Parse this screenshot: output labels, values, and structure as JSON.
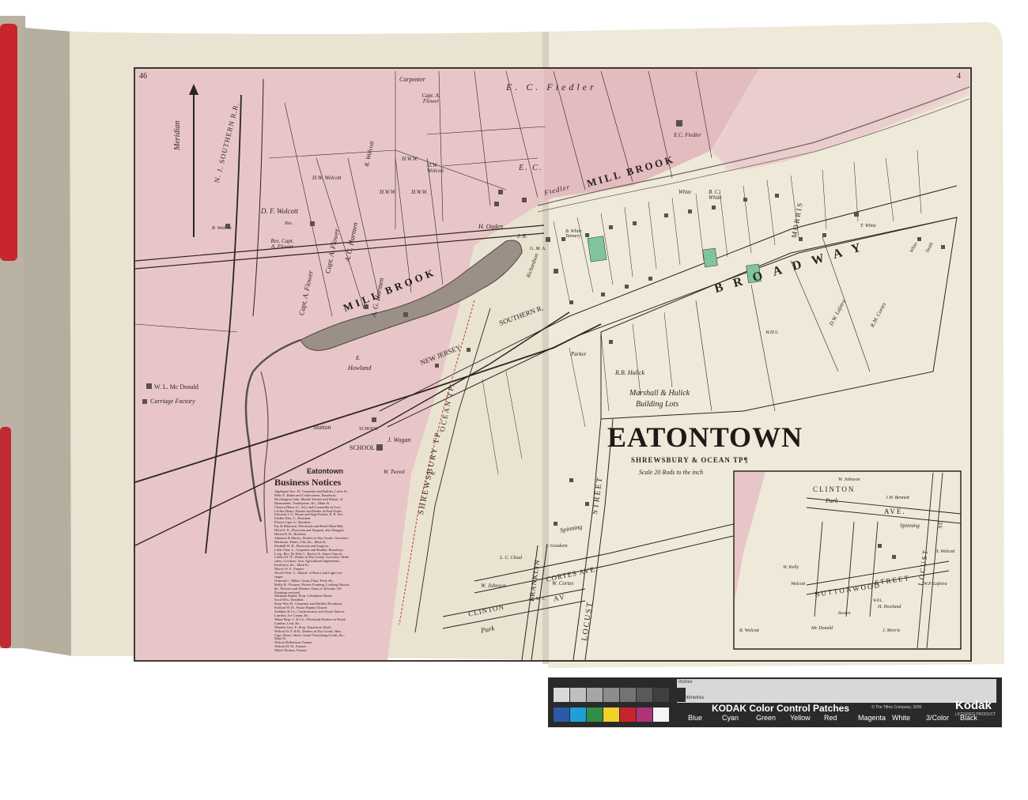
{
  "page": {
    "left_number": "46",
    "right_number": "4",
    "town_title": "EATONTOWN",
    "township": "SHREWSBURY & OCEAN TP¶",
    "scale_note": "Scale 20 Rods to the inch"
  },
  "compass": {
    "label": "Meridian"
  },
  "railroads": {
    "nj_southern": "N. J. SOUTHERN R.R.",
    "southern_r": "SOUTHERN R.",
    "new_jersey": "NEW JERSEY"
  },
  "waterways": {
    "mill_brook_upper": "MILL BROOK",
    "mill_brook_pond": "MILL BROOK"
  },
  "streets": {
    "broadway": "BROADWAY",
    "morris": "MORRIS",
    "shrewsbury_tp": "SHREWSBURY TP.",
    "ocean_tp": "OCEAN TP.",
    "locust": "LOCUST",
    "street": "STREET",
    "franklin": "FRANKLIN",
    "cortes_ave": "CORTES AVE.",
    "clinton": "CLINTON",
    "park": "Park",
    "av": "AV"
  },
  "owners": {
    "carpenter": "Carpenter",
    "ec_fiedler_top": "E. C. Fiedler",
    "ec_fiedler_house": "E.C. Fiedler",
    "ec": "E. C.",
    "fiedler": "Fiedler",
    "capt_a_flower_top": "Capt. A. Flower",
    "r_wolcott": "R. Wolcott",
    "hww_1": "H.W.W.",
    "hww_2": "H.W.W.",
    "hw_wolcott_1": "H.W. Wolcott",
    "hw_wolcott_2": "H.W. Wolcott",
    "hww_3": "H.W.W.",
    "df_wolcott": "D. F. Wolcott",
    "res_1": "Res.",
    "r_wolcott_res": "R. Wolcott",
    "res_capt": "Res. Capt. A. Flower",
    "capt_a_flower_mid": "Capt. A. Flower",
    "ag_harmen_1": "A. G. Harmen",
    "ag_harmen_2": "A. G. Harmen",
    "capt_a_flower_low": "Capt. A. Flower",
    "capt_flower_right": "Capt. A. Flower",
    "ogden": "H. Ogden",
    "jr": "J. R.",
    "gma": "G. M. A.",
    "richardson": "Richardson",
    "b_white_tannery": "B. White Tannery",
    "bc_white": "B. C. White",
    "white": "White",
    "howland": "Howland",
    "e": "E.",
    "station": "Station",
    "school_small": "SCHOOL",
    "school": "SCHOOL",
    "j_wogan": "J. Wogan",
    "w_tweed": "W. Tweed",
    "wl_mcdonald": "W. L. Mc Donald",
    "carriage_factory": "Carriage Factory",
    "marshall_hulick": "Marshall & Hulick",
    "building_lots": "Building Lots",
    "rb_hulick": "R.B. Hulick",
    "parker": "Parker",
    "dw_lafetra": "D.W. Lafetra",
    "rm_cortes": "R.M. Cortes",
    "t_white": "T. White",
    "smith": "Smith",
    "white_r": "White",
    "w_johnson": "W. Johnson",
    "lc_cloud": "L. C. Cloud",
    "w_cortes": "W. Cortes",
    "j_goodwin": "J. Goodwin",
    "spinning": "Spinning",
    "jw_j": "J. W. J.",
    "whs": "W.H.S.",
    "lw": "L.W."
  },
  "business_notices": {
    "town": "Eatontown",
    "heading": "Business Notices",
    "entries": [
      "Applegate Geo. H., Carpenter and Builder, Lewis St.",
      "Beltz F., Baker and Confectioner, Broadway.",
      "Brockington John, Marble Worker and Manuf. of",
      "Monuments, Tombstones, &c., Main St.",
      "Clayton Henry G., Att'y and Counsellor-at-Law.",
      "Corlies Henry, Farmer and Dealer in Real Estate.",
      "Edwards J. S., House and Sign Painter, R. R. Ave.",
      "Fiedler Edw. C., Resident.",
      "Flower Capt. A., Resident.",
      "Fry & Patterson, Wholesale and Retail Meat Mkt.",
      "Hood S. K., Physician and Surgeon, also Druggist.",
      "Hulick R. B., Resident.",
      "Johnston & Morris, Dealers in Dry Goods, Groceries,",
      "Hardware, Paints, Oils, &c., Main St.",
      "Kimball W. B., Physician and Surgeon.",
      "Little Chas. L., Carpenter and Builder, Broadway.",
      "Loop, Rev. De Witt C., Rector St. James Church.",
      "Lafetra D. W., Dealer in Dry Goods, Groceries, Medi-",
      "cines, Crockery, Iron, Agricultural Implements,",
      "Fertilizers, &c., Main St.",
      "Morris W. F., Farmer.",
      "Newell Wm. L., Manuf. of Heavy and Light Car-",
      "riages.",
      "Osmond J., Miller, Grain, Flour, Feed, &c.",
      "Reilly R., Pictures, Picture Framing, Looking Glasses,",
      "&c. Pictures and Window Glass of all kinds. Oil",
      "Paintings restored.",
      "Sherman Daniel, Prop. Columbian House.",
      "Scott Wm., Resident.",
      "Stout Wm. R., Carpenter and Builder, Broadway.",
      "Stafford W. D., Pastor Baptist Church.",
      "Stebbins & Co., Confectionery and Oyster Saloon,",
      "Lunches, Ice Cream, &c.",
      "White Benj. C. & Co., Wholesale Dealers in Wood,",
      "Lumber, Coal, &c.",
      "Wheeler Geo. F., Prop. Eatontown Hotel.",
      "Wolcott D. F. & B., Dealers in Dry Goods, Hats,",
      "Caps, Boots, Shoes, Gents' Furnishing Goods, &c.,",
      "Main St.",
      "Wolcott Robertson, Farmer.",
      "Wolcott H. W., Farmer.",
      "White Thomas, Farmer."
    ]
  },
  "inset": {
    "w_johnson": "W. Johnson",
    "clinton": "CLINTON",
    "park": "Park",
    "jw_bennett": "J.W. Bennett",
    "ave": "AVE.",
    "spinning": "Spinning",
    "locust": "LOCUST",
    "st": "ST.",
    "buttonwood": "BUTTONWOOD",
    "street": "STREET",
    "w_kelly": "W. Kelly",
    "wolcott": "Wolcott",
    "h_howland": "H. Howland",
    "h_wolcott_r": "H. Wolcott",
    "wp_lafetra": "W.P. Lafetra",
    "j_morris": "J. Morris",
    "r_wolcott": "R. Wolcott",
    "mc_donald": "Mc Donald",
    "bennett": "Bennett",
    "wpl": "W.P.L."
  },
  "kodak": {
    "title": "KODAK Color Control Patches",
    "copyright": "© The Tiffen Company, 2000",
    "brand": "Kodak",
    "brand_sub": "LICENSED PRODUCT",
    "inches": "Inches",
    "centimeters": "Centimetres",
    "patches": [
      "Blue",
      "Cyan",
      "Green",
      "Yellow",
      "Red",
      "Magenta",
      "White",
      "3/Color",
      "Black"
    ],
    "colors": {
      "blue": "#2a5aa8",
      "cyan": "#1f9fd8",
      "green": "#2f8f4a",
      "yellow": "#f0d22a",
      "red": "#c8242b",
      "magenta": "#b2327a",
      "white": "#f5f5f5",
      "three_color": "#3a3a3a",
      "black": "#0d0d0d"
    }
  },
  "colors": {
    "paper": "#ebe3d1",
    "paper_right": "#efe9d9",
    "pink": "#e8c6c8",
    "pink_deep": "#dba9ae",
    "water": "#9a9088",
    "ink": "#2b2420",
    "green_lot": "#7fc49d",
    "binding": "#c8c2b3",
    "red_ribbon": "#c8262e"
  }
}
